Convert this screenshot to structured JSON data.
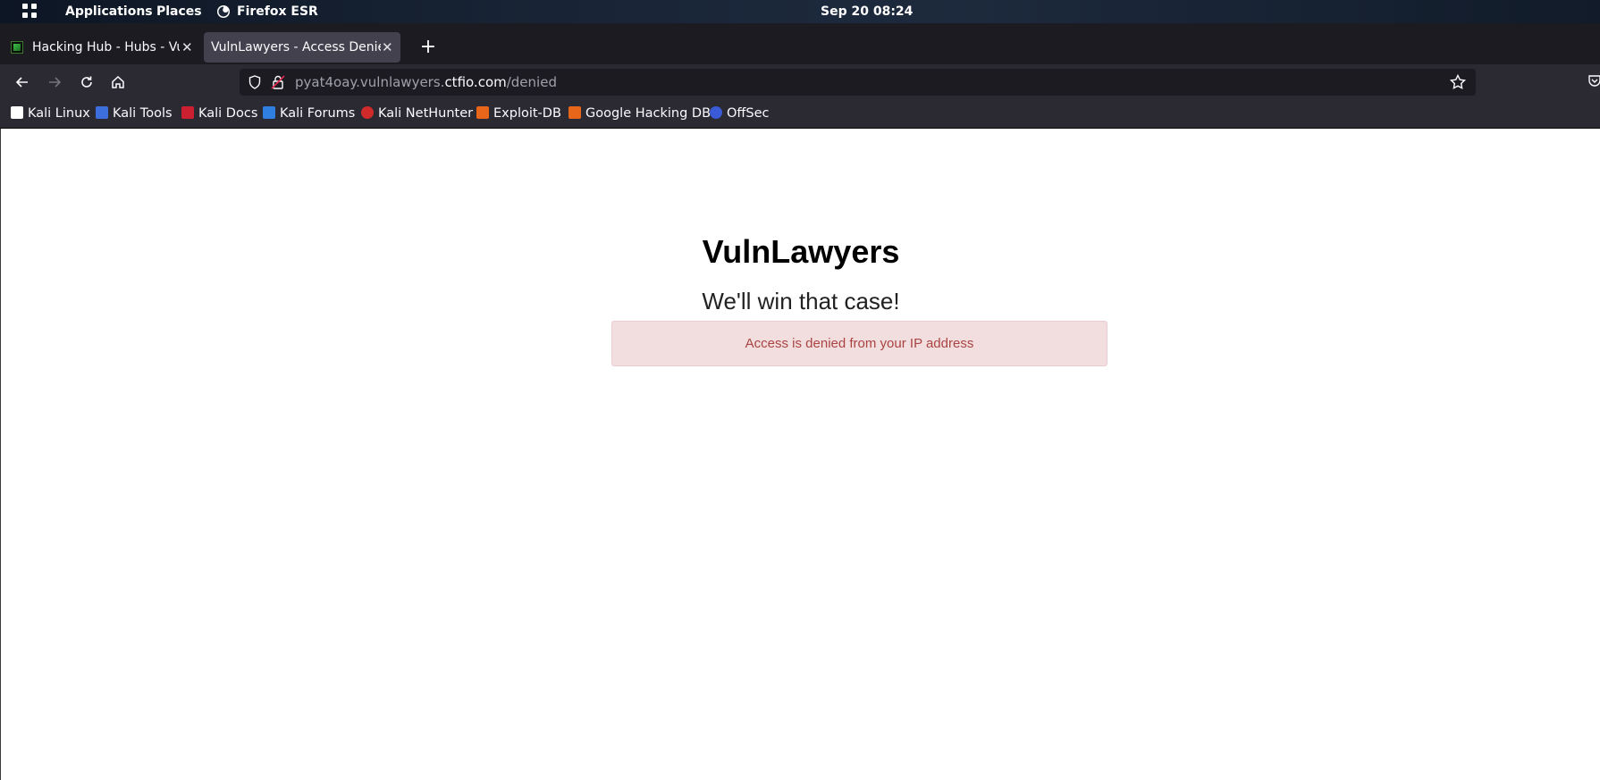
{
  "desktop": {
    "applications_label": "Applications",
    "places_label": "Places",
    "app_label": "Firefox ESR",
    "clock": "Sep 20  08:24"
  },
  "tabs": [
    {
      "title": "Hacking Hub - Hubs - Vuln",
      "active": false,
      "icon": "hackinghub-icon"
    },
    {
      "title": "VulnLawyers - Access Denied",
      "active": true
    }
  ],
  "navbar": {
    "url_prefix": "pyat4oay.vulnlawyers.",
    "url_host": "ctfio.com",
    "url_path": "/denied"
  },
  "bookmarks": [
    {
      "label": "Kali Linux",
      "icon": "kali-dragon-icon",
      "color": "#111111"
    },
    {
      "label": "Kali Tools",
      "icon": "kali-tools-icon",
      "color": "#3d6fdc"
    },
    {
      "label": "Kali Docs",
      "icon": "kali-docs-icon",
      "color": "#cc1f2f"
    },
    {
      "label": "Kali Forums",
      "icon": "kali-forums-icon",
      "color": "#2f7fe0"
    },
    {
      "label": "Kali NetHunter",
      "icon": "nethunter-icon",
      "color": "#d02a2a"
    },
    {
      "label": "Exploit-DB",
      "icon": "exploit-db-icon",
      "color": "#e8661a"
    },
    {
      "label": "Google Hacking DB",
      "icon": "ghdb-icon",
      "color": "#e8661a"
    },
    {
      "label": "OffSec",
      "icon": "offsec-icon",
      "color": "#3b5bd6"
    }
  ],
  "page": {
    "title": "VulnLawyers",
    "subtitle": "We'll win that case!",
    "alert": "Access is denied from your IP address"
  }
}
